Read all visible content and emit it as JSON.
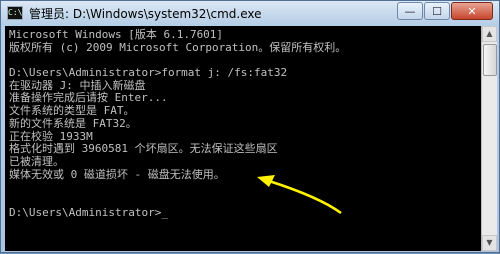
{
  "window": {
    "title": "管理员: D:\\Windows\\system32\\cmd.exe",
    "icon": "cmd-icon",
    "buttons": {
      "minimize": "—",
      "maximize": "☐",
      "close": "✕"
    }
  },
  "console": {
    "lines": [
      "Microsoft Windows [版本 6.1.7601]",
      "版权所有 (c) 2009 Microsoft Corporation。保留所有权利。",
      "",
      "D:\\Users\\Administrator>format j: /fs:fat32",
      "在驱动器 J: 中插入新磁盘",
      "准备操作完成后请按 Enter...",
      "文件系统的类型是 FAT。",
      "新的文件系统是 FAT32。",
      "正在校验 1933M",
      "格式化时遇到 3960581 个坏扇区。无法保证这些扇区",
      "已被清理。",
      "媒体无效或 0 磁道损坏 - 磁盘无法使用。",
      "",
      "",
      "D:\\Users\\Administrator>"
    ],
    "cursor": "_"
  },
  "colors": {
    "console_bg": "#000000",
    "console_text": "#c0c0c0",
    "annotation_arrow": "#fff200"
  }
}
